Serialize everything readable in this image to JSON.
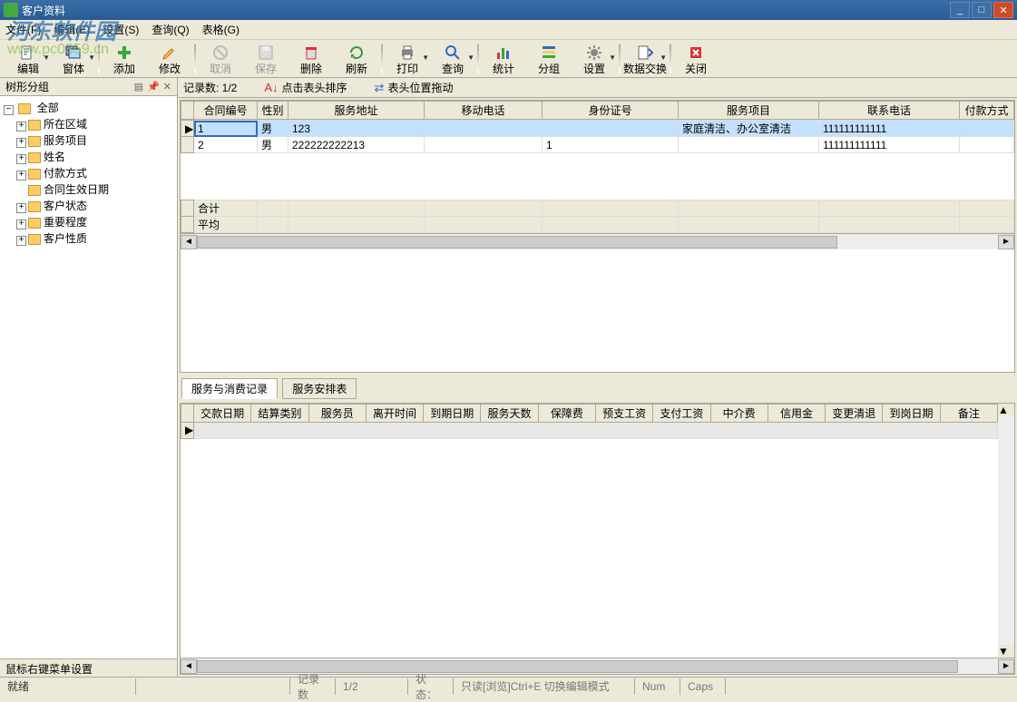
{
  "window": {
    "title": "客户资料"
  },
  "watermark": {
    "line1": "河东软件园",
    "line2": "www.pc0359.cn"
  },
  "menu": {
    "file": "文件(F)",
    "edit": "编辑(E)",
    "settings": "设置(S)",
    "query": "查询(Q)",
    "grid": "表格(G)"
  },
  "toolbar": {
    "edit": "编辑",
    "window": "窗体",
    "add": "添加",
    "modify": "修改",
    "cancel": "取消",
    "save": "保存",
    "delete": "删除",
    "refresh": "刷新",
    "print": "打印",
    "query": "查询",
    "stats": "统计",
    "group": "分组",
    "config": "设置",
    "exchange": "数据交换",
    "close": "关闭"
  },
  "sidebar": {
    "title": "树形分组",
    "root": "全部",
    "items": [
      "所在区域",
      "服务项目",
      "姓名",
      "付款方式",
      "合同生效日期",
      "客户状态",
      "重要程度",
      "客户性质"
    ],
    "footer": "鼠标右键菜单设置"
  },
  "infobar": {
    "records": "记录数: 1/2",
    "sort_label": "点击表头排序",
    "drag_label": "表头位置拖动"
  },
  "main_grid": {
    "columns": [
      "合同编号",
      "性别",
      "服务地址",
      "移动电话",
      "身份证号",
      "服务项目",
      "联系电话",
      "付款方式"
    ],
    "rows": [
      {
        "ind": "1",
        "cols": [
          "",
          "男",
          "123",
          "",
          "",
          "家庭清洁、办公室清洁",
          "111111111111",
          ""
        ]
      },
      {
        "ind": "2",
        "cols": [
          "",
          "男",
          "222222222213",
          "",
          "1",
          "",
          "111111111111",
          ""
        ]
      }
    ],
    "footer_rows": [
      "合计",
      "平均"
    ]
  },
  "sub_tabs": {
    "records": "服务与消费记录",
    "schedule": "服务安排表"
  },
  "sub_grid": {
    "columns": [
      "交款日期",
      "结算类别",
      "服务员",
      "离开时间",
      "到期日期",
      "服务天数",
      "保障费",
      "预支工资",
      "支付工资",
      "中介费",
      "信用金",
      "变更清退",
      "到岗日期",
      "备注"
    ]
  },
  "statusbar": {
    "ready": "就绪",
    "rec_label": "记录数",
    "rec_val": "1/2",
    "state_label": "状态：",
    "state_val": "只读[浏览]Ctrl+E 切换编辑模式",
    "num": "Num",
    "caps": "Caps"
  }
}
